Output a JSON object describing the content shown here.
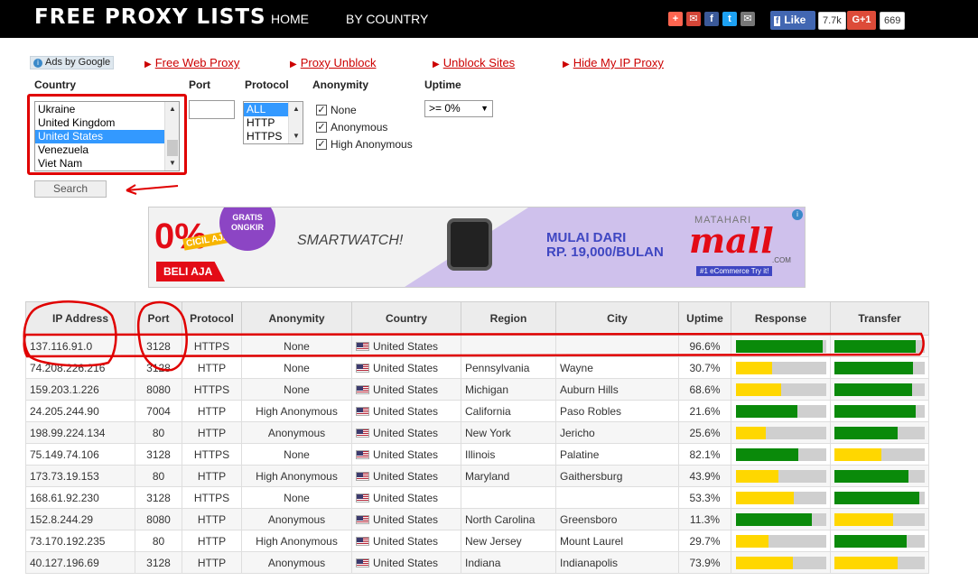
{
  "header": {
    "logo": "FREE PROXY LISTS",
    "nav": [
      "HOME",
      "BY COUNTRY"
    ],
    "share_icons": [
      {
        "name": "plus-share-icon",
        "glyph": "+",
        "color": "#ff6550"
      },
      {
        "name": "email-share-icon",
        "glyph": "✉",
        "color": "#d44638"
      },
      {
        "name": "facebook-share-icon",
        "glyph": "f",
        "color": "#3b5998"
      },
      {
        "name": "twitter-share-icon",
        "glyph": "t",
        "color": "#1da1f2"
      },
      {
        "name": "mail-share-icon",
        "glyph": "✉",
        "color": "#777777"
      }
    ],
    "like_label": "Like",
    "like_count": "7.7k",
    "gplus_label": "G+1",
    "gplus_count": "669"
  },
  "links": {
    "ads_label": "Ads by Google",
    "items": [
      "Free Web Proxy",
      "Proxy Unblock",
      "Unblock Sites",
      "Hide My IP Proxy"
    ]
  },
  "filters": {
    "country_label": "Country",
    "port_label": "Port",
    "protocol_label": "Protocol",
    "anonymity_label": "Anonymity",
    "uptime_label": "Uptime",
    "country_options": [
      "Ukraine",
      "United Kingdom",
      "United States",
      "Venezuela",
      "Viet Nam"
    ],
    "country_selected": "United States",
    "port_value": "",
    "protocol_options": [
      "ALL",
      "HTTP",
      "HTTPS"
    ],
    "protocol_selected": "ALL",
    "anonymity_options": [
      {
        "label": "None",
        "checked": true
      },
      {
        "label": "Anonymous",
        "checked": true
      },
      {
        "label": "High Anonymous",
        "checked": true
      }
    ],
    "uptime_value": ">= 0%",
    "search_label": "Search"
  },
  "ad": {
    "pct": "0%",
    "cicil": "CICIL AJA",
    "beli": "BELI AJA",
    "gratis": "GRATIS ONGKIR",
    "smartwatch": "SMARTWATCH!",
    "mulai_line1": "MULAI DARI",
    "mulai_line2": "RP. 19,000/BULAN",
    "brand_top": "MATAHARI",
    "brand": "mall",
    "brand_com": ".COM",
    "badge": "#1 eCommerce Try it!"
  },
  "table": {
    "headers": [
      "IP Address",
      "Port",
      "Protocol",
      "Anonymity",
      "Country",
      "Region",
      "City",
      "Uptime",
      "Response",
      "Transfer"
    ],
    "rows": [
      {
        "ip": "137.116.91.0",
        "port": "3128",
        "protocol": "HTTPS",
        "anonymity": "None",
        "country": "United States",
        "region": "",
        "city": "",
        "uptime": "96.6%",
        "response": 0.96,
        "response_color": "#0a8a0a",
        "transfer": 0.9,
        "transfer_color": "#0a8a0a"
      },
      {
        "ip": "74.208.226.216",
        "port": "3128",
        "protocol": "HTTP",
        "anonymity": "None",
        "country": "United States",
        "region": "Pennsylvania",
        "city": "Wayne",
        "uptime": "30.7%",
        "response": 0.4,
        "response_color": "#ffd700",
        "transfer": 0.87,
        "transfer_color": "#0a8a0a"
      },
      {
        "ip": "159.203.1.226",
        "port": "8080",
        "protocol": "HTTPS",
        "anonymity": "None",
        "country": "United States",
        "region": "Michigan",
        "city": "Auburn Hills",
        "uptime": "68.6%",
        "response": 0.5,
        "response_color": "#ffd700",
        "transfer": 0.86,
        "transfer_color": "#0a8a0a"
      },
      {
        "ip": "24.205.244.90",
        "port": "7004",
        "protocol": "HTTP",
        "anonymity": "High Anonymous",
        "country": "United States",
        "region": "California",
        "city": "Paso Robles",
        "uptime": "21.6%",
        "response": 0.68,
        "response_color": "#0a8a0a",
        "transfer": 0.9,
        "transfer_color": "#0a8a0a"
      },
      {
        "ip": "198.99.224.134",
        "port": "80",
        "protocol": "HTTP",
        "anonymity": "Anonymous",
        "country": "United States",
        "region": "New York",
        "city": "Jericho",
        "uptime": "25.6%",
        "response": 0.33,
        "response_color": "#ffd700",
        "transfer": 0.7,
        "transfer_color": "#0a8a0a"
      },
      {
        "ip": "75.149.74.106",
        "port": "3128",
        "protocol": "HTTPS",
        "anonymity": "None",
        "country": "United States",
        "region": "Illinois",
        "city": "Palatine",
        "uptime": "82.1%",
        "response": 0.69,
        "response_color": "#0a8a0a",
        "transfer": 0.52,
        "transfer_color": "#ffd700"
      },
      {
        "ip": "173.73.19.153",
        "port": "80",
        "protocol": "HTTP",
        "anonymity": "High Anonymous",
        "country": "United States",
        "region": "Maryland",
        "city": "Gaithersburg",
        "uptime": "43.9%",
        "response": 0.47,
        "response_color": "#ffd700",
        "transfer": 0.82,
        "transfer_color": "#0a8a0a"
      },
      {
        "ip": "168.61.92.230",
        "port": "3128",
        "protocol": "HTTPS",
        "anonymity": "None",
        "country": "United States",
        "region": "",
        "city": "",
        "uptime": "53.3%",
        "response": 0.64,
        "response_color": "#ffd700",
        "transfer": 0.94,
        "transfer_color": "#0a8a0a"
      },
      {
        "ip": "152.8.244.29",
        "port": "8080",
        "protocol": "HTTP",
        "anonymity": "Anonymous",
        "country": "United States",
        "region": "North Carolina",
        "city": "Greensboro",
        "uptime": "11.3%",
        "response": 0.84,
        "response_color": "#0a8a0a",
        "transfer": 0.65,
        "transfer_color": "#ffd700"
      },
      {
        "ip": "73.170.192.235",
        "port": "80",
        "protocol": "HTTP",
        "anonymity": "High Anonymous",
        "country": "United States",
        "region": "New Jersey",
        "city": "Mount Laurel",
        "uptime": "29.7%",
        "response": 0.36,
        "response_color": "#ffd700",
        "transfer": 0.8,
        "transfer_color": "#0a8a0a"
      },
      {
        "ip": "40.127.196.69",
        "port": "3128",
        "protocol": "HTTP",
        "anonymity": "Anonymous",
        "country": "United States",
        "region": "Indiana",
        "city": "Indianapolis",
        "uptime": "73.9%",
        "response": 0.63,
        "response_color": "#ffd700",
        "transfer": 0.7,
        "transfer_color": "#ffd700"
      }
    ]
  }
}
